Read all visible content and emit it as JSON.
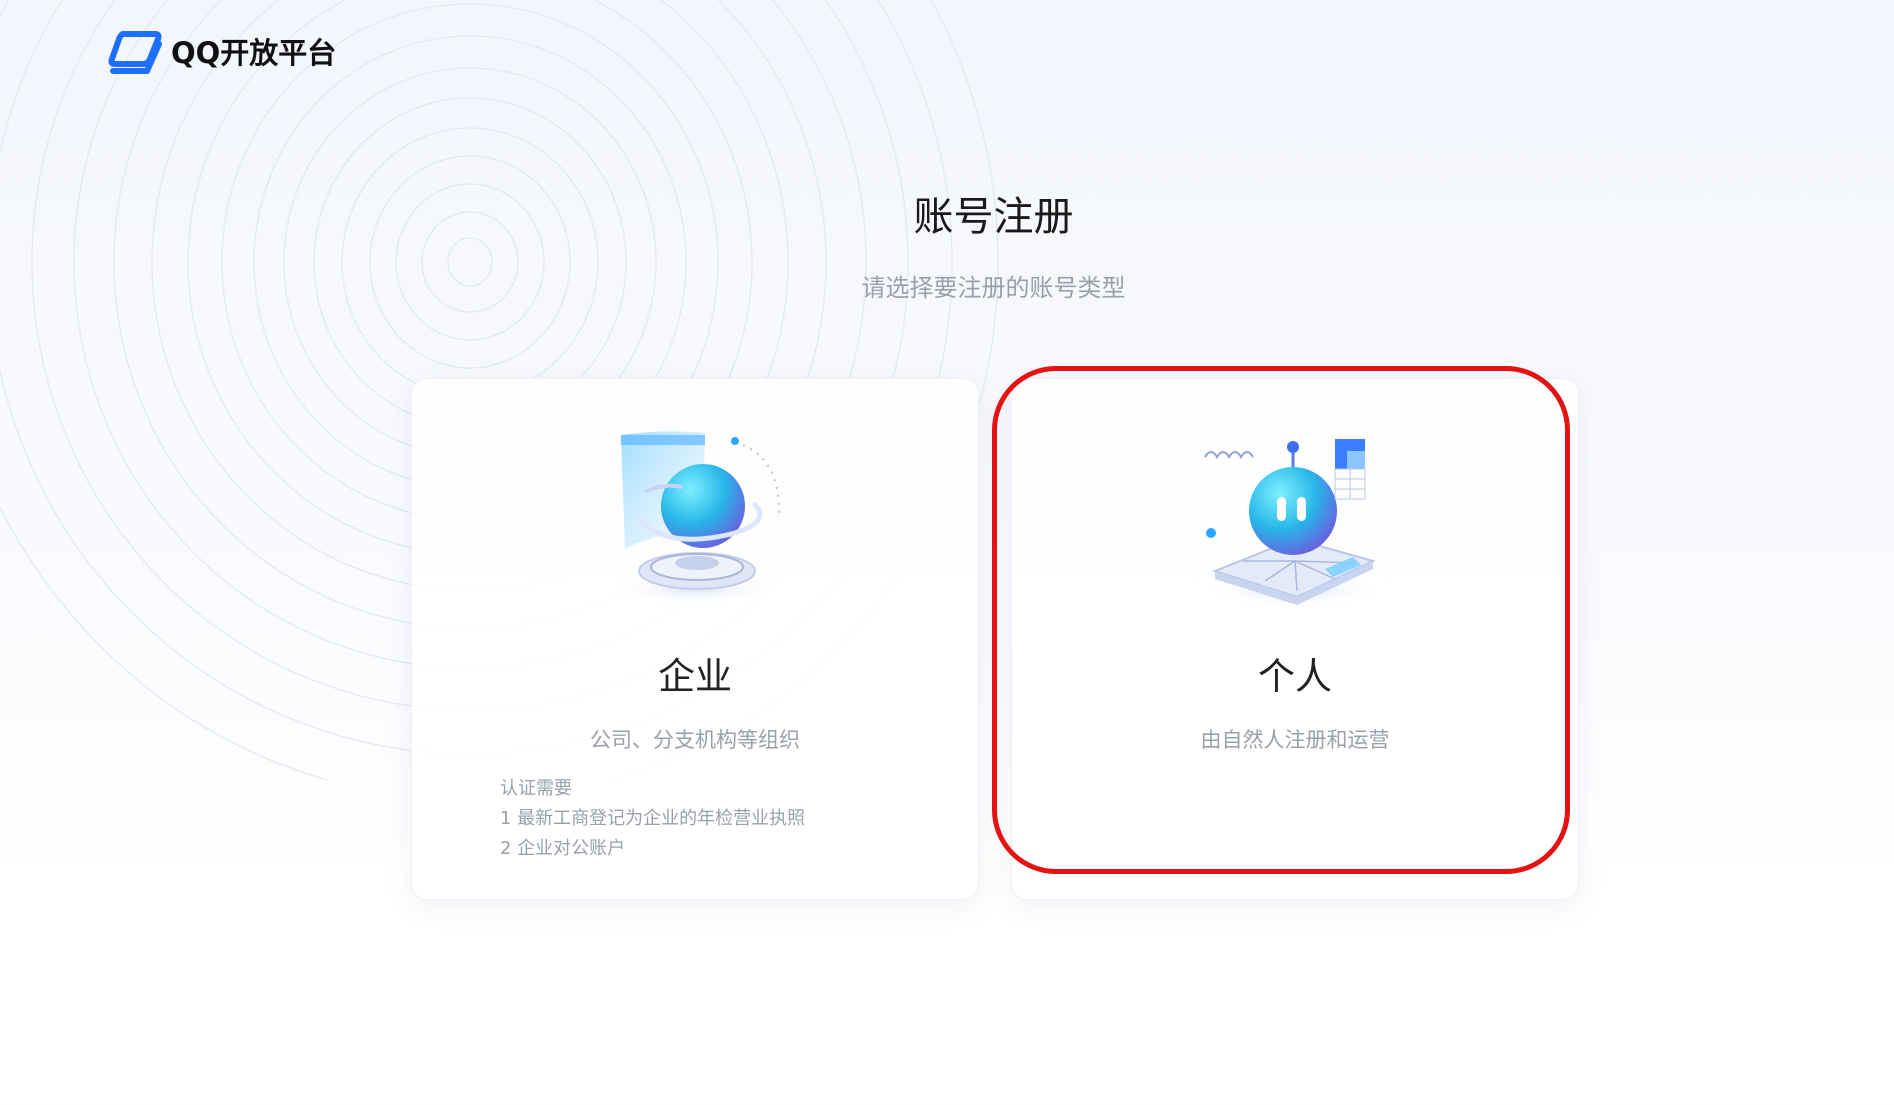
{
  "header": {
    "logo_text": "QQ开放平台"
  },
  "page": {
    "title": "账号注册",
    "subtitle": "请选择要注册的账号类型"
  },
  "cards": {
    "enterprise": {
      "title": "企业",
      "description": "公司、分支机构等组织",
      "requirements_heading": "认证需要",
      "requirements": [
        "1  最新工商登记为企业的年检营业执照",
        "2  企业对公账户"
      ]
    },
    "personal": {
      "title": "个人",
      "description": "由自然人注册和运营"
    }
  },
  "colors": {
    "brand_blue": "#1f6fff",
    "highlight_red": "#e51212",
    "muted_text": "#9aa0ab"
  }
}
